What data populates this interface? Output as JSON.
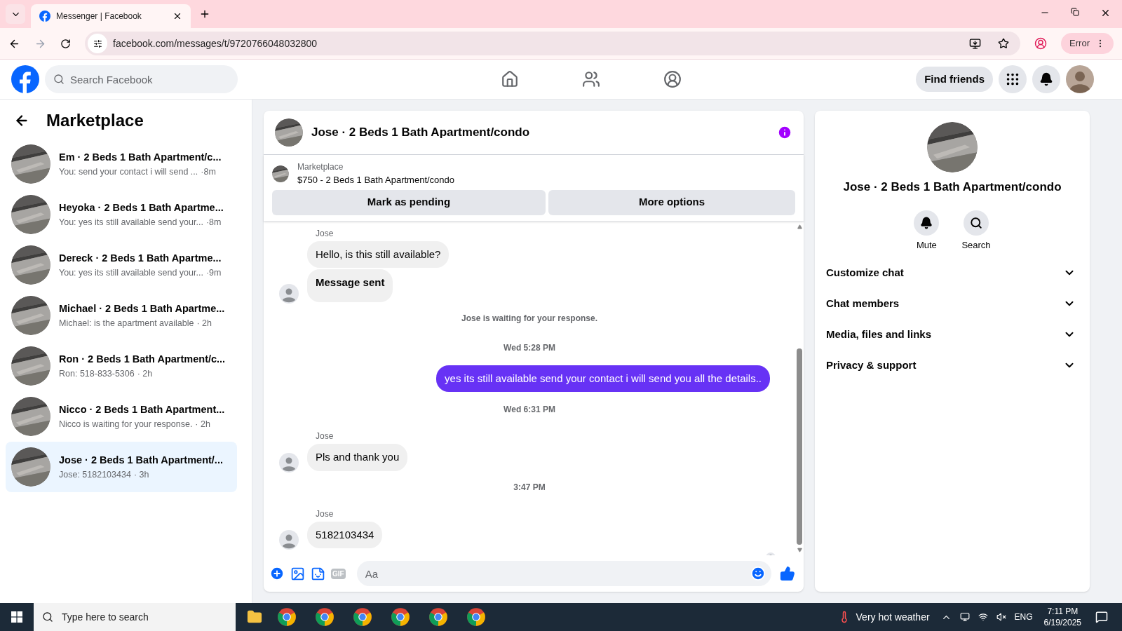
{
  "browser": {
    "tab_title": "Messenger | Facebook",
    "url": "facebook.com/messages/t/9720766048032800",
    "profile_label": "Error"
  },
  "header": {
    "search_placeholder": "Search Facebook",
    "find_friends": "Find friends"
  },
  "sidebar": {
    "title": "Marketplace",
    "conversations": [
      {
        "name": "Em · 2 Beds 1 Bath Apartment/c...",
        "preview": "You: send your contact i will send ...",
        "time": "·8m",
        "selected": false
      },
      {
        "name": "Heyoka · 2 Beds 1 Bath Apartme...",
        "preview": "You: yes its still available send your...",
        "time": "·8m",
        "selected": false
      },
      {
        "name": "Dereck · 2 Beds 1 Bath Apartme...",
        "preview": "You: yes its still available send your...",
        "time": "·9m",
        "selected": false
      },
      {
        "name": "Michael · 2 Beds 1 Bath Apartme...",
        "preview": "Michael: is the apartment available",
        "time": "· 2h",
        "selected": false
      },
      {
        "name": "Ron · 2 Beds 1 Bath Apartment/c...",
        "preview": "Ron: 518-833-5306",
        "time": "· 2h",
        "selected": false
      },
      {
        "name": "Nicco · 2 Beds 1 Bath Apartment...",
        "preview": "Nicco is waiting for your response.",
        "time": "· 2h",
        "selected": false
      },
      {
        "name": "Jose · 2 Beds 1 Bath Apartment/...",
        "preview": "Jose: 5182103434",
        "time": "· 3h",
        "selected": true
      }
    ]
  },
  "chat": {
    "title": "Jose · 2 Beds 1 Bath Apartment/condo",
    "listing_source": "Marketplace",
    "listing_title": "$750 - 2 Beds 1 Bath Apartment/condo",
    "buttons": [
      "Mark as pending",
      "More options"
    ],
    "messages": [
      {
        "kind": "incoming",
        "sender": "Jose",
        "bubbles": [
          {
            "text": "Hello, is this still available?",
            "bold": false
          },
          {
            "text": "Message sent",
            "bold": true
          }
        ]
      },
      {
        "kind": "notice",
        "text": "Jose is waiting for your response."
      },
      {
        "kind": "time",
        "text": "Wed 5:28 PM"
      },
      {
        "kind": "outgoing",
        "text": "yes its still available send your contact i will send you all the details.."
      },
      {
        "kind": "time",
        "text": "Wed 6:31 PM"
      },
      {
        "kind": "incoming",
        "sender": "Jose",
        "bubbles": [
          {
            "text": "Pls and thank you",
            "bold": false
          }
        ]
      },
      {
        "kind": "time",
        "text": "3:47 PM"
      },
      {
        "kind": "incoming",
        "sender": "Jose",
        "bubbles": [
          {
            "text": "5182103434",
            "bold": false
          }
        ]
      }
    ],
    "gif_label": "GIF",
    "composer_placeholder": "Aa"
  },
  "details": {
    "name": "Jose · 2 Beds 1 Bath Apartment/condo",
    "actions": [
      {
        "kind": "mute",
        "label": "Mute"
      },
      {
        "kind": "search",
        "label": "Search"
      }
    ],
    "sections": [
      {
        "label": "Customize chat",
        "expanded": false
      },
      {
        "label": "Chat members",
        "expanded": false
      },
      {
        "label": "Media, files and links",
        "expanded": false
      },
      {
        "label": "Privacy & support",
        "expanded": false
      }
    ]
  },
  "taskbar": {
    "search_placeholder": "Type here to search",
    "weather": "Very hot weather",
    "language": "ENG",
    "time": "7:11 PM",
    "date": "6/19/2025"
  }
}
